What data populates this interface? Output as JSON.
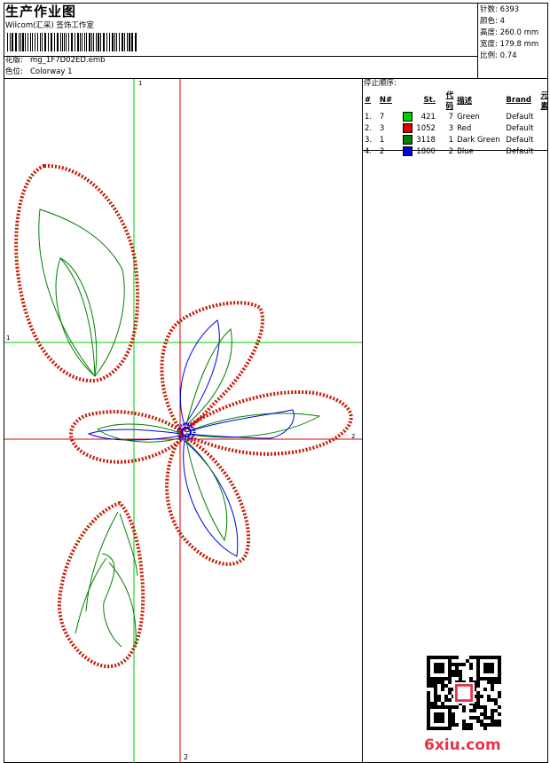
{
  "header": {
    "title": "生产作业图",
    "company": "Wilcom(汇采) 签饰工作室",
    "design_label": "花版:",
    "design_file": "mg_1F7D02ED.emb",
    "colorway_label": "色位:",
    "colorway": "Colorway 1"
  },
  "stats": [
    {
      "label": "针数:",
      "value": "6393"
    },
    {
      "label": "颜色:",
      "value": "4"
    },
    {
      "label": "高度:",
      "value": "260.0 mm"
    },
    {
      "label": "宽度:",
      "value": "179.8 mm"
    },
    {
      "label": "比例:",
      "value": "0.74"
    }
  ],
  "stop_sequence": {
    "title": "停止顺序:",
    "headers": [
      "#",
      "N#",
      "St.",
      "代码",
      "描述",
      "Brand",
      "元素"
    ],
    "rows": [
      {
        "seq": "1.",
        "n": "7",
        "color": "#00d000",
        "stitches": "421",
        "code": "7",
        "desc": "Green",
        "brand": "Default"
      },
      {
        "seq": "2.",
        "n": "3",
        "color": "#e00000",
        "stitches": "1052",
        "code": "3",
        "desc": "Red",
        "brand": "Default"
      },
      {
        "seq": "3.",
        "n": "1",
        "color": "#008000",
        "stitches": "3118",
        "code": "1",
        "desc": "Dark Green",
        "brand": "Default"
      },
      {
        "seq": "4.",
        "n": "2",
        "color": "#0000e0",
        "stitches": "1800",
        "code": "2",
        "desc": "Blue",
        "brand": "Default"
      }
    ]
  },
  "axes": {
    "green_v": "1",
    "green_h": "1",
    "red_h": "2",
    "red_v": "2"
  },
  "colors": {
    "green_axis": "#00cc00",
    "red_axis": "#dd0000",
    "satin_red": "#e00000",
    "satin_green": "#00c000",
    "run_green": "#008000",
    "run_blue": "#0000e0",
    "watermark": "#e8344a"
  },
  "watermark": {
    "site": "6xiu.com",
    "qr_icon": "qr-code-icon"
  }
}
